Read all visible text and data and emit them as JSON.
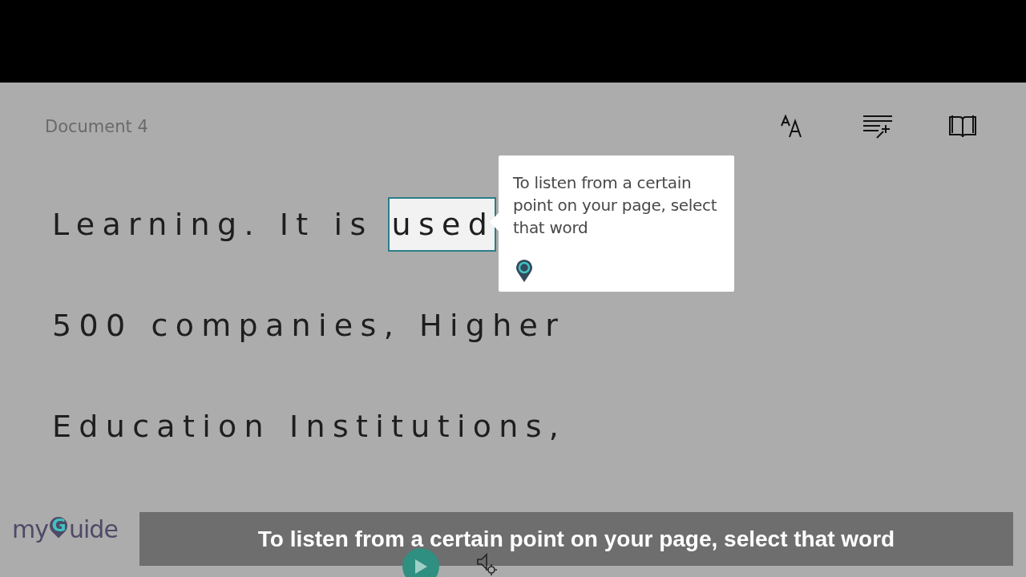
{
  "document": {
    "title": "Document 4"
  },
  "toolbar": [
    {
      "kind": "text-size"
    },
    {
      "kind": "text-preferences"
    },
    {
      "kind": "reading-preferences"
    }
  ],
  "lines": [
    {
      "words": [
        {
          "text": "Learning.",
          "selected": false
        },
        {
          "text": "It",
          "selected": false
        },
        {
          "text": "is",
          "selected": false
        },
        {
          "text": "used",
          "selected": true
        }
      ]
    },
    {
      "words": [
        {
          "text": "500",
          "selected": false
        },
        {
          "text": "companies,",
          "selected": false
        },
        {
          "text": "Higher",
          "selected": false
        }
      ]
    },
    {
      "words": [
        {
          "text": "Education",
          "selected": false
        },
        {
          "text": "Institutions,",
          "selected": false
        }
      ]
    }
  ],
  "tooltip": {
    "text": "To listen from a certain point on your page, select that word"
  },
  "logo": {
    "prefix": "my",
    "mark": "G",
    "suffix": "uide"
  },
  "caption": {
    "text": "To listen from a certain point on your page, select that word"
  }
}
